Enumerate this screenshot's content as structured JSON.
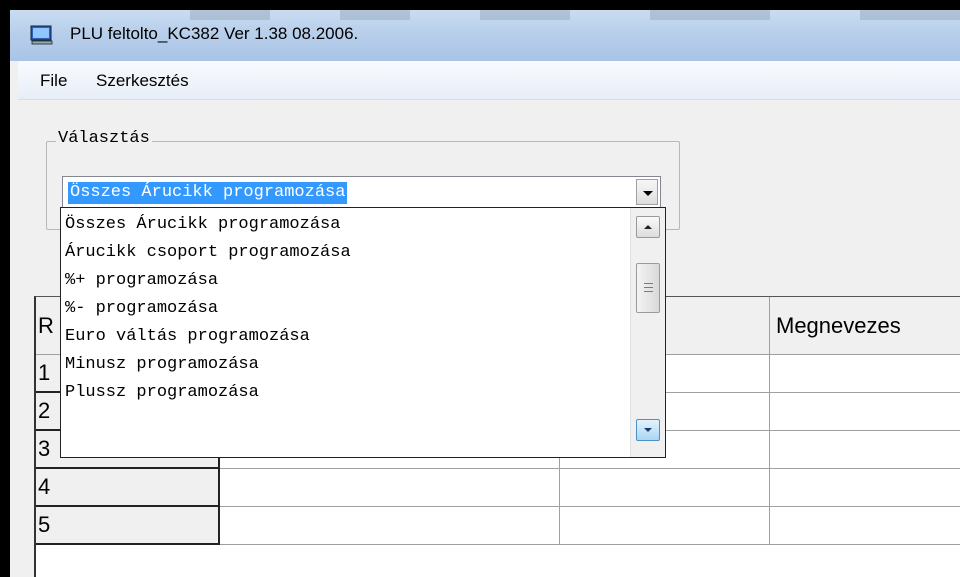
{
  "window": {
    "title": "PLU feltolto_KC382 Ver 1.38  08.2006."
  },
  "menu": {
    "items": [
      "File",
      "Szerkesztés"
    ]
  },
  "selection": {
    "group_label": "Választás",
    "combo_value": "Összes Árucikk programozása",
    "options": [
      "Összes Árucikk programozása",
      "Árucikk csoport programozása",
      "%+ programozása",
      "%- programozása",
      "Euro váltás programozása",
      "Minusz programozása",
      "Plussz programozása"
    ]
  },
  "grid": {
    "corner_header": "R",
    "columns": [
      "",
      "",
      "Megnevezes"
    ],
    "rows": [
      "1",
      "2",
      "3",
      "4",
      "5"
    ]
  },
  "colors": {
    "selection_highlight": "#3399ff",
    "titlebar": "#b8cfeb"
  },
  "icons": {
    "app": "monitor-app-icon",
    "dropdown": "chevron-down-icon"
  }
}
